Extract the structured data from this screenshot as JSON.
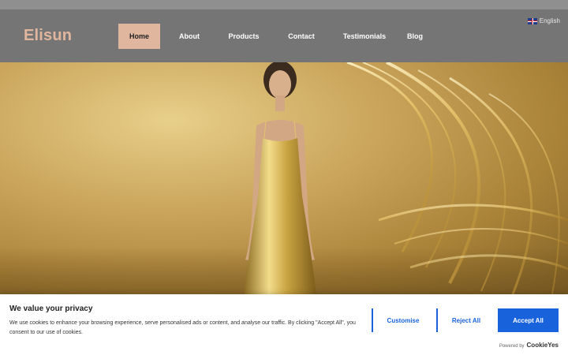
{
  "header": {
    "language": "English",
    "logo": "Elisun",
    "nav": [
      {
        "label": "Home",
        "active": true
      },
      {
        "label": "About",
        "active": false
      },
      {
        "label": "Products",
        "active": false
      },
      {
        "label": "Contact",
        "active": false
      },
      {
        "label": "Testimonials",
        "active": false
      },
      {
        "label": "Blog",
        "active": false
      }
    ]
  },
  "cookie": {
    "title": "We value your privacy",
    "text": "We use cookies to enhance your browsing experience, serve personalised ads or content, and analyse our traffic. By clicking \"Accept All\", you consent to our use of cookies.",
    "customise_label": "Customise",
    "reject_label": "Reject All",
    "accept_label": "Accept All",
    "powered_by": "Powered by",
    "powered_brand": "CookieYes"
  },
  "colors": {
    "accent": "#e1b69e",
    "header_bg": "#757575",
    "button_blue": "#1863dc"
  }
}
